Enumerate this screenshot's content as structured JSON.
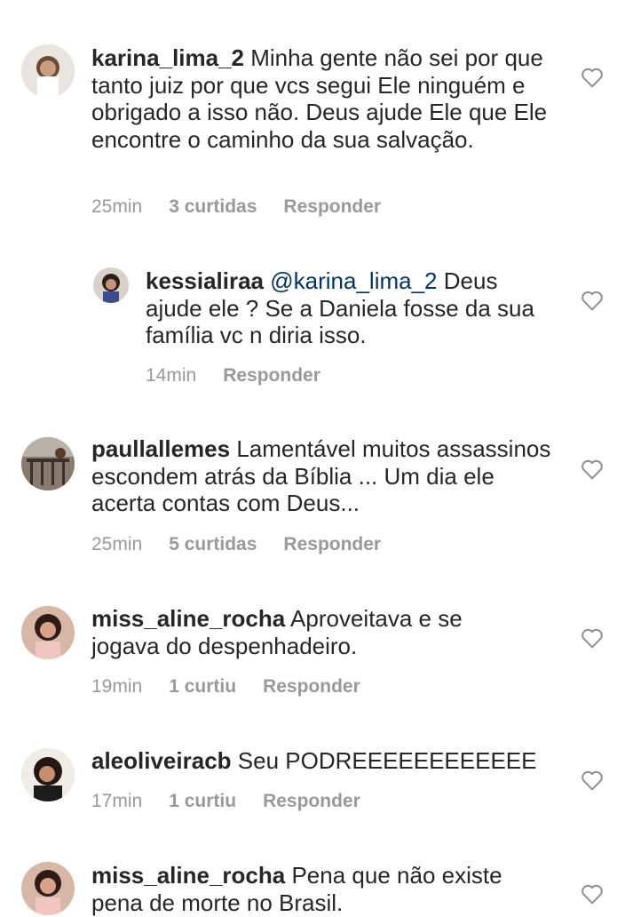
{
  "comments": [
    {
      "username": "karina_lima_2",
      "mention": "",
      "text": "Minha gente não sei por que tanto juiz por que vcs segui Ele ninguém e obrigado a isso não. Deus ajude Ele que Ele encontre o caminho da sua salvação.",
      "time": "25min",
      "likes": "3 curtidas",
      "reply": "Responder",
      "liked": false
    },
    {
      "username": "kessialiraa",
      "mention": "@karina_lima_2",
      "text": "Deus ajude ele ? Se a Daniela fosse da sua família vc n diria isso.",
      "time": "14min",
      "likes": "",
      "reply": "Responder",
      "liked": false
    },
    {
      "username": "paullallemes",
      "mention": "",
      "text": "Lamentável muitos assassinos escondem atrás da Bíblia ... Um dia ele acerta contas com Deus...",
      "time": "25min",
      "likes": "5 curtidas",
      "reply": "Responder",
      "liked": false
    },
    {
      "username": "miss_aline_rocha",
      "mention": "",
      "text": "Aproveitava e se jogava do despenhadeiro.",
      "time": "19min",
      "likes": "1 curtiu",
      "reply": "Responder",
      "liked": false
    },
    {
      "username": "aleoliveiracb",
      "mention": "",
      "text": "Seu PODREEEEEEEEEEEE",
      "time": "17min",
      "likes": "1 curtiu",
      "reply": "Responder",
      "liked": false
    },
    {
      "username": "miss_aline_rocha",
      "mention": "",
      "text": "Pena que não existe pena de morte no Brasil.",
      "time": "",
      "likes": "",
      "reply": "",
      "liked": false
    }
  ],
  "colors": {
    "text": "#262626",
    "meta": "#999999",
    "mention": "#003569",
    "heart": "#8e8e8e"
  }
}
